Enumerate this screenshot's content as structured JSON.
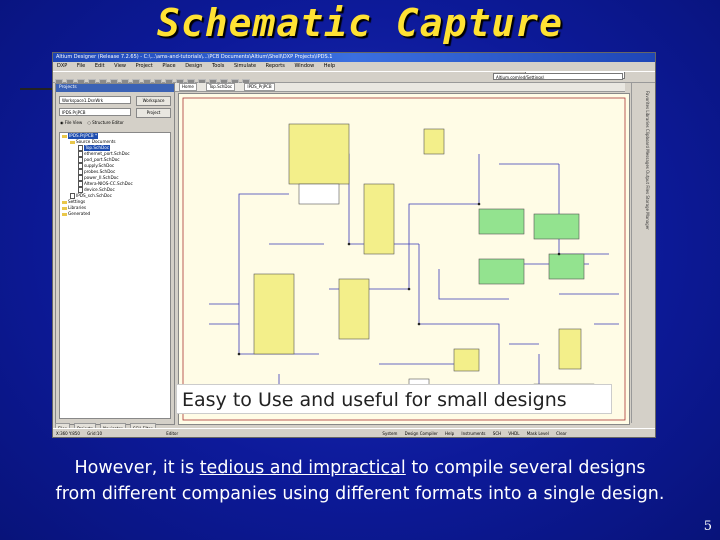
{
  "slide": {
    "title": "Schematic Capture",
    "caption": "Easy to Use and useful for small designs",
    "body_line1_pre": "However, it is ",
    "body_line1_underlined": "tedious and impractical",
    "body_line1_post": " to compile several designs",
    "body_line2": "from different companies using different formats into a single design.",
    "slide_number": "5"
  },
  "app": {
    "window_title": "Altium Designer (Release 7.2.65) - C:\\...\\ams-and-tutorials\\...\\PCB Documents\\Altium\\Shell\\DXP Projects\\IPDS.1",
    "menu": [
      "DXP",
      "File",
      "Edit",
      "View",
      "Project",
      "Place",
      "Design",
      "Tools",
      "Simulate",
      "Reports",
      "Window",
      "Help"
    ],
    "path_field": "Altium.com/ed/Settings\\",
    "version_field": "(No versions)",
    "panel": {
      "header": "Projects",
      "workspace_field": "Workspace1.DsnWrk",
      "workspace_button": "Workspace",
      "project_field": "IPDS.PrjPCB",
      "project_button": "Project",
      "file_view": "File View",
      "structure_editor": "Structure Editor"
    },
    "tree": [
      {
        "label": "IPDS.PrjPCB *",
        "level": 0,
        "type": "folder",
        "selected": true
      },
      {
        "label": "Source Documents",
        "level": 1,
        "type": "folder"
      },
      {
        "label": "Top.SchDoc",
        "level": 2,
        "type": "doc",
        "selected": true
      },
      {
        "label": "ethernet_port.SchDoc",
        "level": 2,
        "type": "doc"
      },
      {
        "label": "pod_port.SchDoc",
        "level": 2,
        "type": "doc"
      },
      {
        "label": "supply.SchDoc",
        "level": 2,
        "type": "doc"
      },
      {
        "label": "probes.SchDoc",
        "level": 2,
        "type": "doc"
      },
      {
        "label": "power_II.SchDoc",
        "level": 2,
        "type": "doc"
      },
      {
        "label": "Altera-NIOS-CC.SchDoc",
        "level": 2,
        "type": "doc"
      },
      {
        "label": "device.SchDoc",
        "level": 2,
        "type": "doc"
      },
      {
        "label": "IPDS_sch.SchDoc",
        "level": 1,
        "type": "doc"
      },
      {
        "label": "Settings",
        "level": 0,
        "type": "folder"
      },
      {
        "label": "Libraries",
        "level": 0,
        "type": "folder"
      },
      {
        "label": "Generated",
        "level": 0,
        "type": "folder"
      }
    ],
    "pane_tabs": [
      "Files",
      "Projects",
      "Navigator",
      "SCH Filter"
    ],
    "doc_strip": [
      "Home",
      "Top.SchDoc",
      "IPDS_PrjPCB"
    ],
    "bottom_tab": "Editor",
    "right_strip_text": "Favorites  Libraries  Clipboard  Messages  Output  Files  Storage Manager",
    "status": {
      "left": "X:360 Y:850",
      "grid": "Grid:10",
      "items": [
        "System",
        "Design Compiler",
        "Help",
        "Instruments",
        "SCH",
        "VHDL",
        "Mask Level",
        "Clear"
      ]
    }
  },
  "colors": {
    "title": "#ffe234",
    "slide_bg": "#0d1a9a",
    "schematic_bg": "#fffce6",
    "chip_yellow": "#f3ef8a",
    "chip_green": "#93e38f",
    "wire": "#3a3ab8"
  }
}
